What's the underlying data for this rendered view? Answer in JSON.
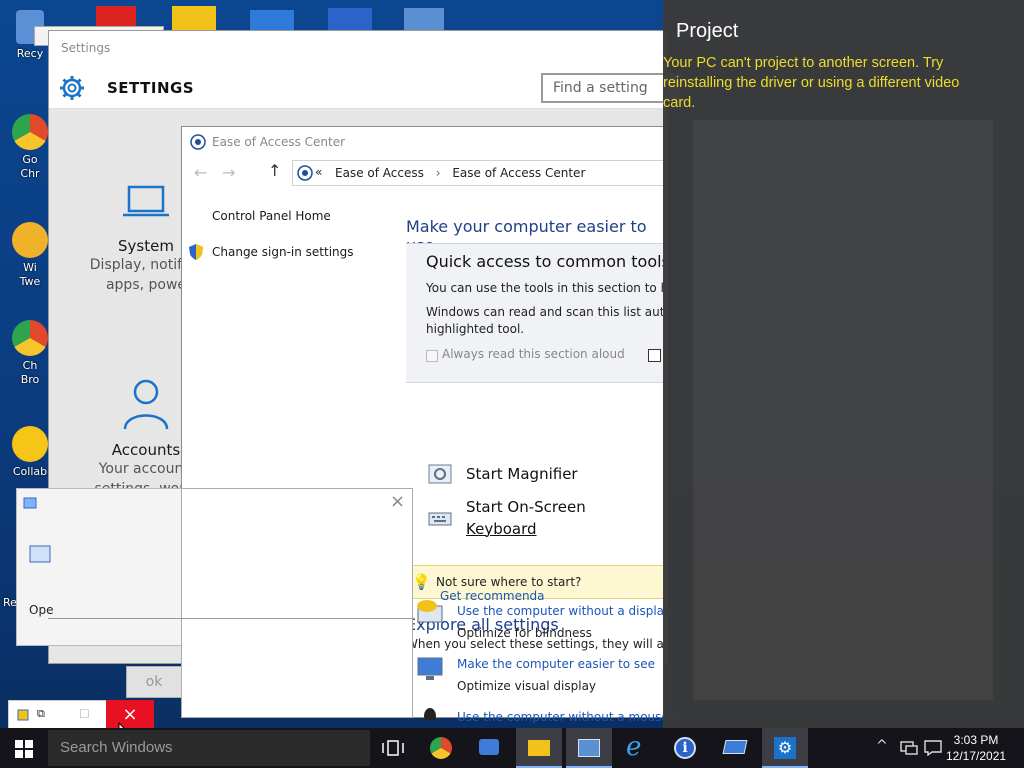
{
  "desktop": {
    "icons": [
      {
        "label": "Recy",
        "color": "#5b8fd6"
      },
      {
        "label": "Go\nChr",
        "color": "#e04a2a"
      },
      {
        "label": "Wi\nTwe",
        "color": "#f0b22a"
      },
      {
        "label": "Ch\nBro",
        "color": "#e04a2a"
      },
      {
        "label": "Collab",
        "color": "#f5c518"
      },
      {
        "label": "Re",
        "color": "#7fb2ff"
      }
    ]
  },
  "settings_window": {
    "title": "Settings",
    "header": "SETTINGS",
    "search_placeholder": "Find a setting",
    "tiles": [
      {
        "name": "System",
        "desc": "Display, notifica\napps, powe"
      },
      {
        "name": "Accounts",
        "desc": "Your account,\nsettings, work,\nusers"
      }
    ]
  },
  "ease_center": {
    "title": "Ease of Access Center",
    "breadcrumb": [
      "Ease of Access",
      "Ease of Access Center"
    ],
    "breadcrumb_prefix": "«",
    "breadcrumb_sep": "›",
    "left_links": [
      "Control Panel Home",
      "Change sign-in settings"
    ],
    "heading": "Make your computer easier to use",
    "quick": {
      "title": "Quick access to common tools",
      "line1": "You can use the tools in this section to hel",
      "line2": "Windows can read and scan this list automa",
      "line3": "highlighted tool.",
      "checkbox_label": "Always read this section aloud"
    },
    "tools": [
      "Start Magnifier",
      "Start On-Screen",
      "Keyboard"
    ],
    "tip_text": "Not sure where to start?",
    "tip_link": "Get recommenda",
    "explore_heading": "Explore all settings",
    "explore_desc": "When you select these settings, they will auto",
    "settings_links": [
      {
        "link": "Use the computer without a display",
        "desc": "Optimize for blindness"
      },
      {
        "link": "Make the computer easier to see",
        "desc": "Optimize visual display"
      },
      {
        "link": "Use the computer without a mouse or",
        "desc": ""
      }
    ]
  },
  "dialog": {
    "left_text": "Ope",
    "button_label": "ok",
    "close_glyph": "×"
  },
  "project": {
    "title": "Project",
    "message": "Your PC can't project to another screen. Try reinstalling the driver or using a different video card."
  },
  "snap_popup": {
    "close_glyph": "×"
  },
  "taskbar": {
    "search_placeholder": "Search Windows",
    "time": "3:03 PM",
    "date": "12/17/2021",
    "icons": [
      "task-view-icon",
      "chrome-icon",
      "chat-icon",
      "file-explorer-icon",
      "control-panel-icon",
      "edge-ie-icon",
      "info-icon",
      "app-icon",
      "settings-icon"
    ]
  },
  "colors": {
    "accent": "#1a56b8",
    "project_message": "#ecdd2a",
    "close_red": "#e81123",
    "taskbar": "#14141a"
  }
}
